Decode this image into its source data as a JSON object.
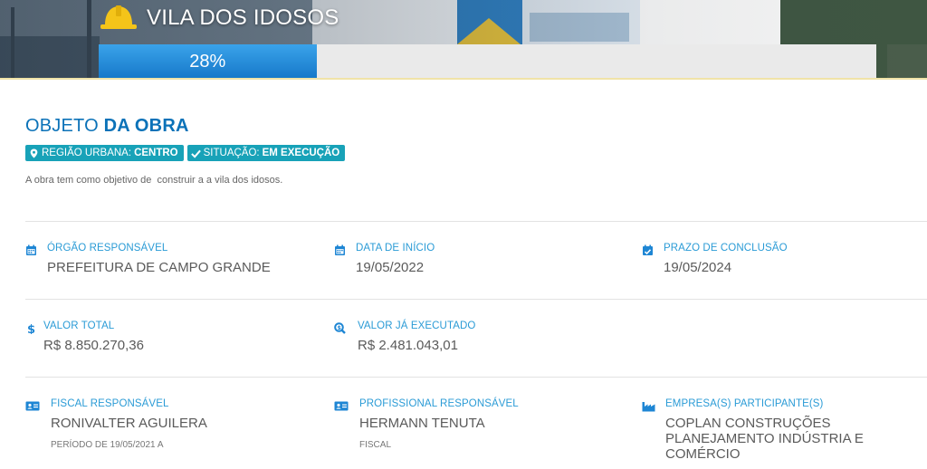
{
  "header": {
    "title": "VILA DOS IDOSOS",
    "progress_percent": 28,
    "progress_label": "28%",
    "icon": "hard-hat-icon"
  },
  "objeto": {
    "title_light": "OBJETO",
    "title_bold": "DA OBRA",
    "tags": [
      {
        "icon": "map-marker-icon",
        "label": "REGIÃO URBANA:",
        "value": "CENTRO"
      },
      {
        "icon": "check-icon",
        "label": "SITUAÇÃO:",
        "value": "EM EXECUÇÃO"
      }
    ],
    "description": "A obra tem como objetivo de  construir a a vila dos idosos."
  },
  "fields": {
    "orgao": {
      "icon": "calendar-icon",
      "label": "ÓRGÃO RESPONSÁVEL",
      "value": "PREFEITURA DE CAMPO GRANDE"
    },
    "data_inicio": {
      "icon": "calendar-icon",
      "label": "DATA DE INÍCIO",
      "value": "19/05/2022"
    },
    "prazo": {
      "icon": "calendar-check-icon",
      "label": "PRAZO DE CONCLUSÃO",
      "value": "19/05/2024"
    },
    "valor_total": {
      "icon": "dollar-icon",
      "label": "VALOR TOTAL",
      "value": "R$ 8.850.270,36"
    },
    "valor_executado": {
      "icon": "search-dollar-icon",
      "label": "VALOR JÁ EXECUTADO",
      "value": "R$ 2.481.043,01"
    },
    "fiscal": {
      "icon": "id-card-icon",
      "label": "FISCAL RESPONSÁVEL",
      "value": "RONIVALTER AGUILERA",
      "sub": "PERÍODO DE 19/05/2021 A"
    },
    "profissional": {
      "icon": "id-card-icon",
      "label": "PROFISSIONAL RESPONSÁVEL",
      "value": "HERMANN TENUTA",
      "sub": "FISCAL"
    },
    "empresa": {
      "icon": "industry-icon",
      "label": "EMPRESA(S) PARTICIPANTE(S)",
      "value": "COPLAN CONSTRUÇÕES PLANEJAMENTO INDÚSTRIA E COMÉRCIO"
    }
  },
  "colors": {
    "accent": "#0b72b8",
    "label": "#2a9bd6",
    "tag": "#18a2b8",
    "progress": "#1e86d4"
  }
}
